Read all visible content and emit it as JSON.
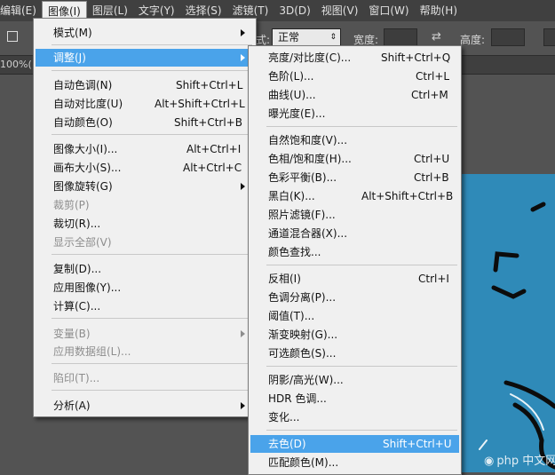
{
  "menubar": {
    "items": [
      {
        "label": "编辑(E)"
      },
      {
        "label": "图像(I)"
      },
      {
        "label": "图层(L)"
      },
      {
        "label": "文字(Y)"
      },
      {
        "label": "选择(S)"
      },
      {
        "label": "滤镜(T)"
      },
      {
        "label": "3D(D)"
      },
      {
        "label": "视图(V)"
      },
      {
        "label": "窗口(W)"
      },
      {
        "label": "帮助(H)"
      }
    ]
  },
  "options_bar": {
    "style_label": "式:",
    "style_value": "正常",
    "width_label": "宽度:",
    "height_label": "高度:"
  },
  "doc": {
    "zoom": "100%("
  },
  "image_menu": {
    "items": [
      {
        "label": "模式(M)",
        "shortcut": ""
      },
      {
        "label": "调整(J)",
        "shortcut": ""
      },
      {
        "label": "自动色调(N)",
        "shortcut": "Shift+Ctrl+L"
      },
      {
        "label": "自动对比度(U)",
        "shortcut": "Alt+Shift+Ctrl+L"
      },
      {
        "label": "自动颜色(O)",
        "shortcut": "Shift+Ctrl+B"
      },
      {
        "label": "图像大小(I)...",
        "shortcut": "Alt+Ctrl+I"
      },
      {
        "label": "画布大小(S)...",
        "shortcut": "Alt+Ctrl+C"
      },
      {
        "label": "图像旋转(G)",
        "shortcut": ""
      },
      {
        "label": "裁剪(P)",
        "shortcut": ""
      },
      {
        "label": "裁切(R)...",
        "shortcut": ""
      },
      {
        "label": "显示全部(V)",
        "shortcut": ""
      },
      {
        "label": "复制(D)...",
        "shortcut": ""
      },
      {
        "label": "应用图像(Y)...",
        "shortcut": ""
      },
      {
        "label": "计算(C)...",
        "shortcut": ""
      },
      {
        "label": "变量(B)",
        "shortcut": ""
      },
      {
        "label": "应用数据组(L)...",
        "shortcut": ""
      },
      {
        "label": "陷印(T)...",
        "shortcut": ""
      },
      {
        "label": "分析(A)",
        "shortcut": ""
      }
    ]
  },
  "adjust_menu": {
    "items": [
      {
        "label": "亮度/对比度(C)...",
        "shortcut": "Shift+Ctrl+Q"
      },
      {
        "label": "色阶(L)...",
        "shortcut": "Ctrl+L"
      },
      {
        "label": "曲线(U)...",
        "shortcut": "Ctrl+M"
      },
      {
        "label": "曝光度(E)...",
        "shortcut": ""
      },
      {
        "label": "自然饱和度(V)...",
        "shortcut": ""
      },
      {
        "label": "色相/饱和度(H)...",
        "shortcut": "Ctrl+U"
      },
      {
        "label": "色彩平衡(B)...",
        "shortcut": "Ctrl+B"
      },
      {
        "label": "黑白(K)...",
        "shortcut": "Alt+Shift+Ctrl+B"
      },
      {
        "label": "照片滤镜(F)...",
        "shortcut": ""
      },
      {
        "label": "通道混合器(X)...",
        "shortcut": ""
      },
      {
        "label": "颜色查找...",
        "shortcut": ""
      },
      {
        "label": "反相(I)",
        "shortcut": "Ctrl+I"
      },
      {
        "label": "色调分离(P)...",
        "shortcut": ""
      },
      {
        "label": "阈值(T)...",
        "shortcut": ""
      },
      {
        "label": "渐变映射(G)...",
        "shortcut": ""
      },
      {
        "label": "可选颜色(S)...",
        "shortcut": ""
      },
      {
        "label": "阴影/高光(W)...",
        "shortcut": ""
      },
      {
        "label": "HDR 色调...",
        "shortcut": ""
      },
      {
        "label": "变化...",
        "shortcut": ""
      },
      {
        "label": "去色(D)",
        "shortcut": "Shift+Ctrl+U"
      },
      {
        "label": "匹配颜色(M)...",
        "shortcut": ""
      }
    ]
  },
  "watermark": {
    "text": "php 中文网"
  },
  "colors": {
    "highlight": "#4aa3ea",
    "menu_bg": "#f0f0f0",
    "canvas": "#2f8ab8"
  }
}
